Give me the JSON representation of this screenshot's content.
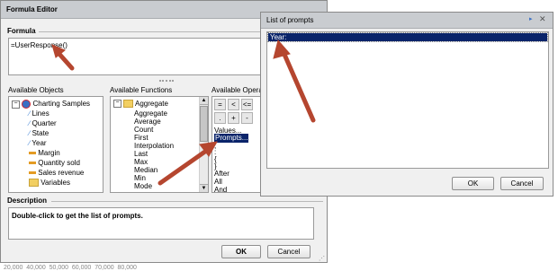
{
  "background": {
    "axis_ticks": "20,000  40,000  50,000  60,000  70,000  80,000"
  },
  "formula_editor": {
    "title": "Formula Editor",
    "formula_label": "Formula",
    "formula_value": "=UserResponse()",
    "available_objects_label": "Available Objects",
    "objects": [
      {
        "label": "Charting Samples",
        "icon": "universe-icon"
      },
      {
        "label": "Lines",
        "icon": "dimension-icon"
      },
      {
        "label": "Quarter",
        "icon": "dimension-icon"
      },
      {
        "label": "State",
        "icon": "dimension-icon"
      },
      {
        "label": "Year",
        "icon": "dimension-icon"
      },
      {
        "label": "Margin",
        "icon": "measure-icon"
      },
      {
        "label": "Quantity sold",
        "icon": "measure-icon"
      },
      {
        "label": "Sales revenue",
        "icon": "measure-icon"
      },
      {
        "label": "Variables",
        "icon": "folder-icon"
      }
    ],
    "available_functions_label": "Available Functions",
    "functions": [
      "Aggregate",
      "Aggregate",
      "Average",
      "Count",
      "First",
      "Interpolation",
      "Last",
      "Max",
      "Median",
      "Min",
      "Mode"
    ],
    "available_operators_label": "Available Operato",
    "operators_row1": [
      "=",
      "<",
      "<="
    ],
    "operators_row2": [
      ".",
      "+",
      "-"
    ],
    "operator_list": [
      "Values...",
      "Prompts...",
      ";",
      ":",
      "{",
      "}",
      "After",
      "All",
      "And"
    ],
    "description_label": "Description",
    "description_text": "Double-click to get the list of prompts.",
    "ok_label": "OK",
    "cancel_label": "Cancel"
  },
  "prompts_dialog": {
    "title": "List of prompts",
    "items": [
      "Year:"
    ],
    "ok_label": "OK",
    "cancel_label": "Cancel"
  },
  "colors": {
    "arrow": "#b5462f",
    "selection": "#0a246a",
    "titlebar": "#c9ccd0"
  }
}
